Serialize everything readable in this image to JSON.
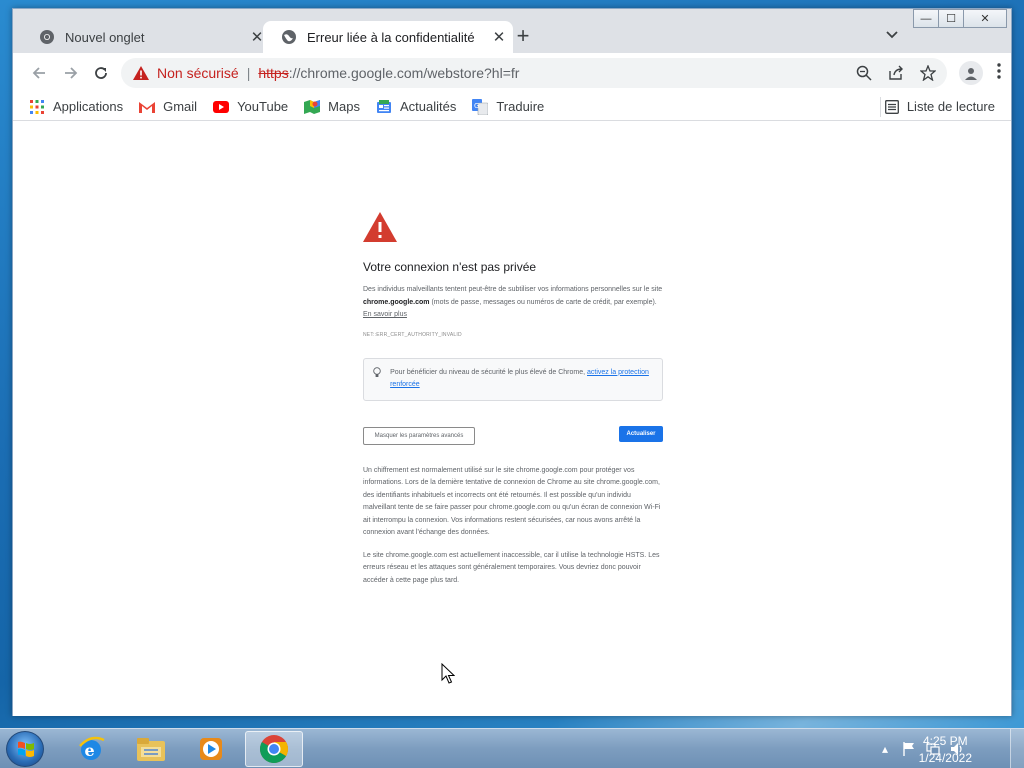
{
  "window_controls": {
    "minimize": "—",
    "maximize": "☐",
    "close": "✕"
  },
  "tabs": [
    {
      "title": "Nouvel onglet",
      "close": "✕"
    },
    {
      "title": "Erreur liée à la confidentialité",
      "close": "✕"
    }
  ],
  "new_tab": "+",
  "omnibox": {
    "security_label": "Non sécurisé",
    "separator": "|",
    "url_scheme": "https",
    "url_rest": "://chrome.google.com/webstore?hl=fr"
  },
  "bookmarks": [
    {
      "label": "Applications",
      "icon": "apps-grid-icon"
    },
    {
      "label": "Gmail",
      "icon": "gmail-icon"
    },
    {
      "label": "YouTube",
      "icon": "youtube-icon"
    },
    {
      "label": "Maps",
      "icon": "maps-icon"
    },
    {
      "label": "Actualités",
      "icon": "news-icon"
    },
    {
      "label": "Traduire",
      "icon": "translate-icon"
    }
  ],
  "reading_list": "Liste de lecture",
  "interstitial": {
    "heading": "Votre connexion n'est pas privée",
    "explain_pre": "Des individus malveillants tentent peut-être de subtiliser vos informations personnelles sur le site ",
    "explain_site": "chrome.google.com",
    "explain_post": " (mots de passe, messages ou numéros de carte de crédit, par exemple). ",
    "learn_more": "En savoir plus",
    "error_code": "NET::ERR_CERT_AUTHORITY_INVALID",
    "enhanced_text": "Pour bénéficier du niveau de sécurité le plus élevé de Chrome, ",
    "enhanced_link": "activez la protection renforcée",
    "hide_advanced": "Masquer les paramètres avancés",
    "reload": "Actualiser",
    "details_1": "Un chiffrement est normalement utilisé sur le site chrome.google.com pour protéger vos informations. Lors de la dernière tentative de connexion de Chrome au site chrome.google.com, des identifiants inhabituels et incorrects ont été retournés. Il est possible qu'un individu malveillant tente de se faire passer pour chrome.google.com ou qu'un écran de connexion Wi-Fi ait interrompu la connexion. Vos informations restent sécurisées, car nous avons arrêté la connexion avant l'échange des données.",
    "details_2": "Le site chrome.google.com est actuellement inaccessible, car il utilise la technologie HSTS. Les erreurs réseau et les attaques sont généralement temporaires. Vous devriez donc pouvoir accéder à cette page plus tard."
  },
  "taskbar": {
    "apps": [
      "internet-explorer-icon",
      "file-explorer-icon",
      "media-player-icon",
      "chrome-icon"
    ],
    "clock_time": "4:25 PM",
    "clock_date": "1/24/2022"
  },
  "colors": {
    "accent": "#1a73e8",
    "danger": "#c5221f"
  }
}
